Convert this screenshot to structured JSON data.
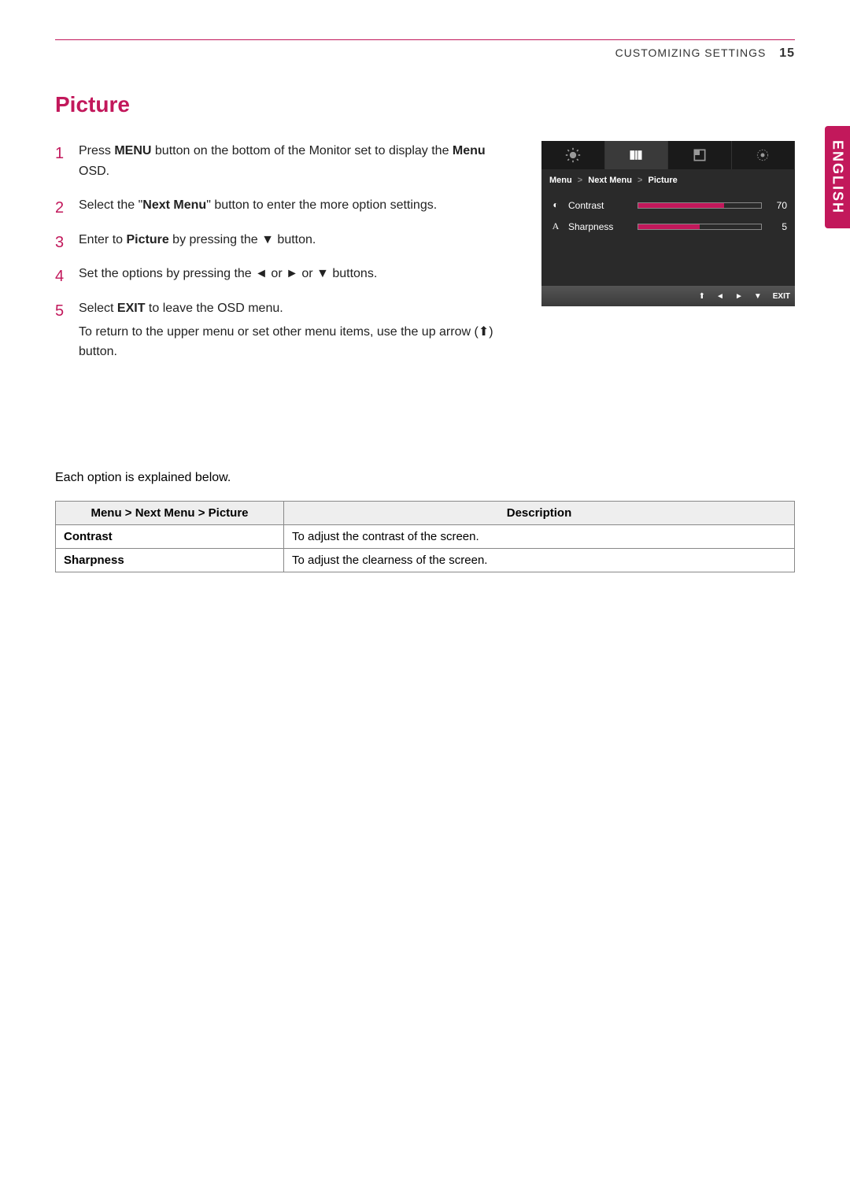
{
  "header": {
    "section": "CUSTOMIZING SETTINGS",
    "page": "15"
  },
  "language_tab": "ENGLISH",
  "title": "Picture",
  "steps": [
    {
      "pre": "Press ",
      "b1": "MENU",
      "mid": " button on the bottom of the Monitor set to display the ",
      "b2": "Menu",
      "post": " OSD."
    },
    {
      "pre": "Select the \"",
      "b1": "Next Menu",
      "mid": "\" button to enter the more option settings.",
      "b2": "",
      "post": ""
    },
    {
      "pre": "Enter to ",
      "b1": "Picture",
      "mid": " by pressing the ▼ button.",
      "b2": "",
      "post": ""
    },
    {
      "pre": "Set the options by pressing the ◄ or ► or ▼ buttons.",
      "b1": "",
      "mid": "",
      "b2": "",
      "post": ""
    },
    {
      "pre": "Select ",
      "b1": "EXIT",
      "mid": " to leave the OSD menu.",
      "b2": "",
      "post": "",
      "sub": "To return to the upper menu or set other menu items, use the up arrow (⬆) button."
    }
  ],
  "osd": {
    "breadcrumb": [
      "Menu",
      "Next Menu",
      "Picture"
    ],
    "rows": [
      {
        "icon": "◐",
        "label": "Contrast",
        "value": 70,
        "max": 100
      },
      {
        "icon": "A",
        "label": "Sharpness",
        "value": 5,
        "max": 10
      }
    ],
    "footer": [
      "⬆",
      "◄",
      "►",
      "▼",
      "EXIT"
    ]
  },
  "table_intro": "Each option is explained below.",
  "table": {
    "head": [
      "Menu > Next Menu > Picture",
      "Description"
    ],
    "rows": [
      {
        "name": "Contrast",
        "desc": "To adjust the contrast of the screen."
      },
      {
        "name": "Sharpness",
        "desc": "To adjust the clearness of the screen."
      }
    ]
  }
}
